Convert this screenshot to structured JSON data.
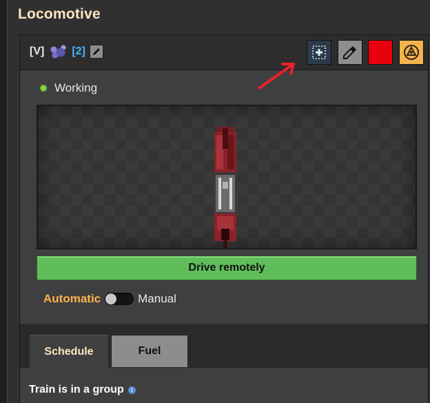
{
  "window": {
    "title": "Locomotive"
  },
  "header": {
    "train_prefix": "[V]",
    "train_number": "[2]",
    "train_icon": "train-group-icon",
    "buttons": [
      {
        "name": "select-button",
        "icon": "selection-icon"
      },
      {
        "name": "color-picker-button",
        "icon": "eyedropper-icon"
      },
      {
        "name": "color-swatch-button",
        "icon": "color-swatch",
        "color": "#e8000f"
      },
      {
        "name": "follow-button",
        "icon": "follow-train-icon"
      }
    ]
  },
  "status": {
    "text": "Working",
    "indicator_color": "#7fdc3a"
  },
  "actions": {
    "drive_remotely": "Drive remotely"
  },
  "mode": {
    "automatic": "Automatic",
    "manual": "Manual",
    "selected": "Automatic"
  },
  "tabs": [
    {
      "label": "Schedule",
      "active": true
    },
    {
      "label": "Fuel",
      "active": false
    }
  ],
  "schedule": {
    "group_text": "Train is in a group",
    "info_icon": "i"
  },
  "colors": {
    "title": "#ffe6c0",
    "drive_button": "#5fbe5a",
    "automatic_label": "#ffb44a",
    "train_number": "#47b6ff",
    "annotation_arrow": "#e8202a"
  }
}
